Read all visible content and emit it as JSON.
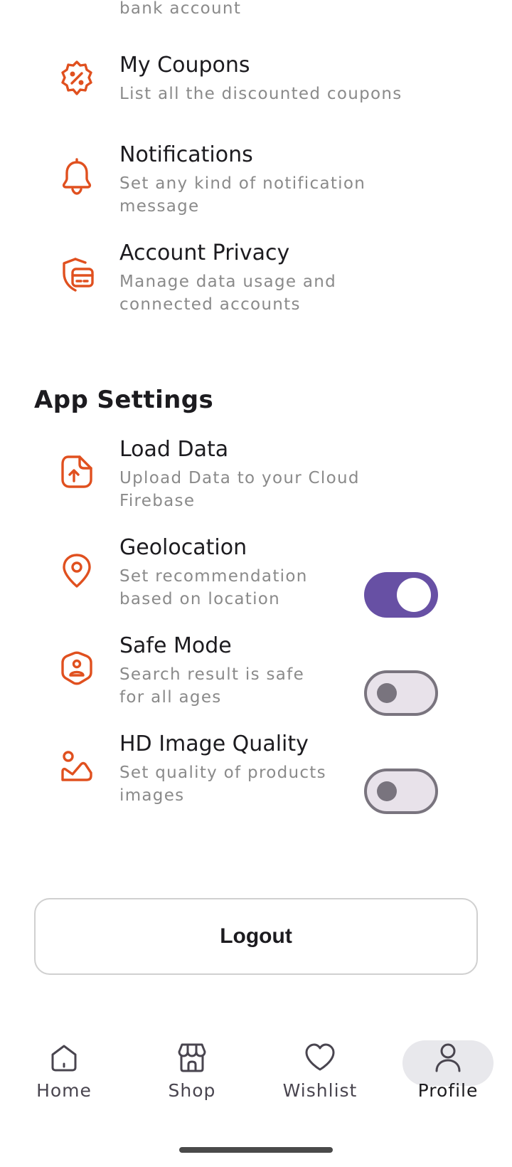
{
  "account_settings": {
    "items": [
      {
        "title": "",
        "subtitle": "bank account",
        "icon": "bank-icon"
      },
      {
        "title": "My Coupons",
        "subtitle": "List all the discounted coupons",
        "icon": "discount-badge-icon"
      },
      {
        "title": "Notifications",
        "subtitle": "Set any kind of notification message",
        "icon": "bell-icon"
      },
      {
        "title": "Account Privacy",
        "subtitle": "Manage data usage and connected accounts",
        "icon": "security-card-icon"
      }
    ]
  },
  "app_settings": {
    "heading": "App Settings",
    "items": [
      {
        "title": "Load Data",
        "subtitle": "Upload Data to your Cloud Firebase",
        "icon": "document-upload-icon"
      },
      {
        "title": "Geolocation",
        "subtitle": "Set recommendation based on location",
        "icon": "location-pin-icon",
        "toggle": true
      },
      {
        "title": "Safe Mode",
        "subtitle": "Search result is safe for all ages",
        "icon": "security-user-icon",
        "toggle": false
      },
      {
        "title": "HD Image Quality",
        "subtitle": "Set quality of products images",
        "icon": "gallery-icon",
        "toggle": false
      }
    ]
  },
  "logout": {
    "label": "Logout"
  },
  "bottom_nav": {
    "items": [
      {
        "label": "Home",
        "icon": "home-icon",
        "active": false
      },
      {
        "label": "Shop",
        "icon": "shop-icon",
        "active": false
      },
      {
        "label": "Wishlist",
        "icon": "heart-icon",
        "active": false
      },
      {
        "label": "Profile",
        "icon": "user-icon",
        "active": true
      }
    ]
  },
  "colors": {
    "accent_icon": "#e0501f",
    "toggle_on": "#6750a4",
    "toggle_off_track": "#e8e2ea",
    "toggle_off_outline": "#79747e",
    "subtitle_text": "#8a8a8a",
    "nav_active_pill": "#e8e8ec"
  }
}
